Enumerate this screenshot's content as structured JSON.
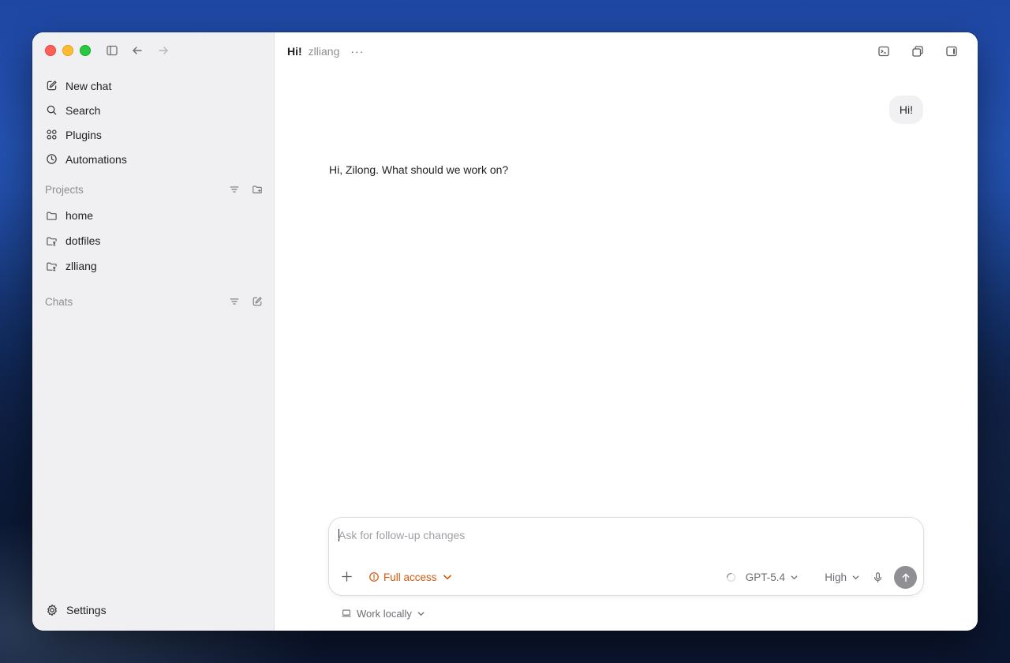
{
  "window": {
    "traffic_lights": [
      "close",
      "minimize",
      "zoom"
    ],
    "toolbar_icons": [
      "sidebar-toggle-icon",
      "back-arrow-icon",
      "forward-arrow-icon"
    ]
  },
  "sidebar": {
    "nav": [
      {
        "label": "New chat",
        "icon": "edit-icon"
      },
      {
        "label": "Search",
        "icon": "search-icon"
      },
      {
        "label": "Plugins",
        "icon": "plugins-icon"
      },
      {
        "label": "Automations",
        "icon": "clock-icon"
      }
    ],
    "projects": {
      "heading": "Projects",
      "items": [
        {
          "label": "home",
          "icon": "folder-icon"
        },
        {
          "label": "dotfiles",
          "icon": "folder-git-icon"
        },
        {
          "label": "zlliang",
          "icon": "folder-git-icon"
        }
      ]
    },
    "chats": {
      "heading": "Chats"
    },
    "settings_label": "Settings"
  },
  "header": {
    "title": "Hi!",
    "subtitle": "zlliang",
    "more": "···"
  },
  "conversation": {
    "user_message": "Hi!",
    "assistant_message": "Hi, Zilong. What should we work on?"
  },
  "composer": {
    "placeholder": "Ask for follow-up changes",
    "access_label": "Full access",
    "model_label": "GPT-5.4",
    "effort_label": "High"
  },
  "footer": {
    "work_location": "Work locally"
  },
  "colors": {
    "accent_warning": "#d25a10",
    "sidebar_bg": "#f0f0f2",
    "send_button": "#8f8f94"
  }
}
